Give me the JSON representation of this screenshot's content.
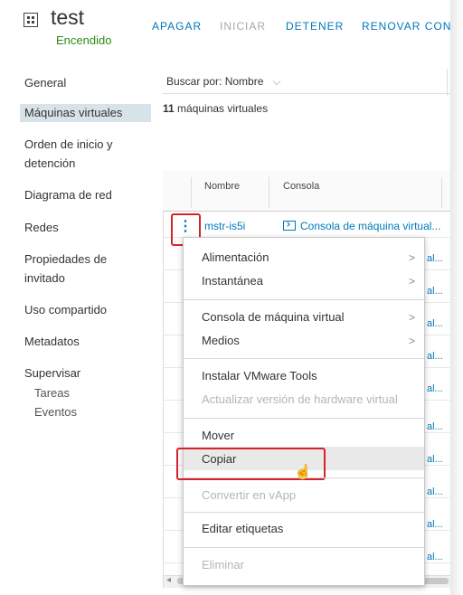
{
  "header": {
    "title": "test",
    "status": "Encendido",
    "actions": [
      {
        "label": "APAGAR",
        "enabled": true
      },
      {
        "label": "INICIAR",
        "enabled": false
      },
      {
        "label": "DETENER",
        "enabled": true
      },
      {
        "label": "RENOVAR CONC",
        "enabled": true
      }
    ]
  },
  "sidebar": {
    "items": [
      {
        "label": "General"
      },
      {
        "label": "Máquinas virtuales",
        "active": true
      },
      {
        "label": "Orden de inicio y"
      },
      {
        "label": "detención"
      },
      {
        "label": "Diagrama de red"
      },
      {
        "label": "Redes"
      },
      {
        "label": "Propiedades de"
      },
      {
        "label": "invitado"
      },
      {
        "label": "Uso compartido"
      },
      {
        "label": "Metadatos"
      },
      {
        "label": "Supervisar"
      },
      {
        "label": "Tareas"
      },
      {
        "label": "Eventos"
      }
    ]
  },
  "main": {
    "filter_label": "Buscar por: Nombre",
    "filter_chevron": "⌵",
    "count_number": "11",
    "count_text": " máquinas virtuales",
    "columns": [
      "Nombre",
      "Consola"
    ],
    "first_row": {
      "name": "mstr-is5i",
      "console": "Consola de máquina virtual..."
    },
    "truncated_cell": "al..."
  },
  "context_menu": {
    "items": [
      {
        "label": "Alimentación",
        "submenu": true,
        "enabled": true
      },
      {
        "label": "Instantánea",
        "submenu": true,
        "enabled": true
      },
      {
        "label": "Consola de máquina virtual",
        "submenu": true,
        "enabled": true
      },
      {
        "label": "Medios",
        "submenu": true,
        "enabled": true
      },
      {
        "label": "Instalar VMware Tools",
        "enabled": true
      },
      {
        "label": "Actualizar versión de hardware virtual",
        "enabled": false
      },
      {
        "label": "Mover",
        "enabled": true
      },
      {
        "label": "Copiar",
        "enabled": true,
        "hovered": true
      },
      {
        "label": "Convertir en vApp",
        "enabled": false
      },
      {
        "label": "Editar etiquetas",
        "enabled": true
      },
      {
        "label": "Eliminar",
        "enabled": false
      }
    ],
    "submenu_glyph": ">"
  },
  "colors": {
    "accent": "#0079b8",
    "status_green": "#2e8a16",
    "highlight_red": "#d5242b",
    "active_nav_bg": "#d8e3e9"
  }
}
